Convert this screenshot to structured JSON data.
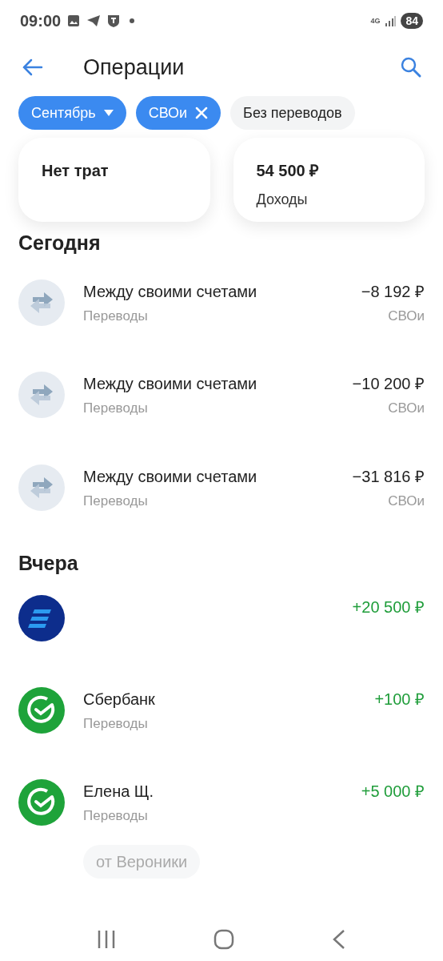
{
  "status_bar": {
    "time": "09:00",
    "network": "4G",
    "battery": "84"
  },
  "header": {
    "title": "Операции"
  },
  "filters": [
    {
      "label": "Сентябрь",
      "selected": true,
      "kind": "dropdown"
    },
    {
      "label": "СВОи",
      "selected": true,
      "kind": "removable"
    },
    {
      "label": "Без переводов",
      "selected": false,
      "kind": "toggle"
    }
  ],
  "summary": [
    {
      "amount": "Нет трат"
    },
    {
      "amount": "54 500 ₽",
      "label": "Доходы"
    }
  ],
  "sections": [
    {
      "title": "Сегодня",
      "operations": [
        {
          "kind": "transfer",
          "title": "Между своими счетами",
          "category": "Переводы",
          "amount": "−8 192 ₽",
          "income": false,
          "account": "СВОи"
        },
        {
          "kind": "transfer",
          "title": "Между своими счетами",
          "category": "Переводы",
          "amount": "−10 200 ₽",
          "income": false,
          "account": "СВОи"
        },
        {
          "kind": "transfer",
          "title": "Между своими счетами",
          "category": "Переводы",
          "amount": "−31 816 ₽",
          "income": false,
          "account": "СВОи"
        }
      ]
    },
    {
      "title": "Вчера",
      "operations": [
        {
          "kind": "bank",
          "amount": "+20 500 ₽",
          "income": true
        },
        {
          "kind": "check",
          "title": "Сбербанк",
          "category": "Переводы",
          "amount": "+100 ₽",
          "income": true
        },
        {
          "kind": "check",
          "title": "Елена Щ.",
          "category": "Переводы",
          "amount": "+5 000 ₽",
          "income": true,
          "comment": "от Вероники"
        }
      ]
    }
  ]
}
